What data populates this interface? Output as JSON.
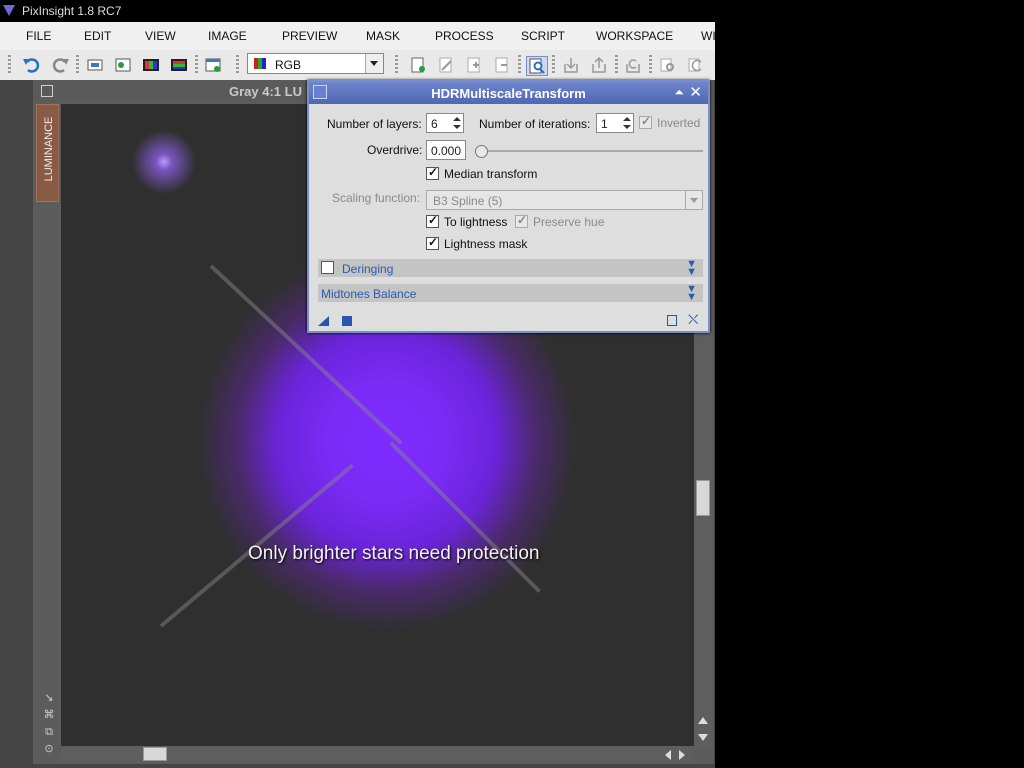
{
  "window": {
    "title": "PixInsight 1.8 RC7"
  },
  "menu": [
    "FILE",
    "EDIT",
    "VIEW",
    "IMAGE",
    "PREVIEW",
    "MASK",
    "PROCESS",
    "SCRIPT",
    "WORKSPACE",
    "WI"
  ],
  "toolbar": {
    "color_mode": "RGB"
  },
  "image_window": {
    "title": "Gray 4:1 LU",
    "side_tab": "LUMINANCE",
    "overlay_caption": "Only brighter stars need protection"
  },
  "dialog": {
    "title": "HDRMultiscaleTransform",
    "layers_label": "Number of layers:",
    "layers_value": "6",
    "iterations_label": "Number of iterations:",
    "iterations_value": "1",
    "inverted_label": "Inverted",
    "overdrive_label": "Overdrive:",
    "overdrive_value": "0.000",
    "median_label": "Median transform",
    "scaling_label": "Scaling function:",
    "scaling_value": "B3 Spline (5)",
    "to_lightness_label": "To lightness",
    "preserve_hue_label": "Preserve hue",
    "lightness_mask_label": "Lightness mask",
    "deringing_label": "Deringing",
    "midtones_label": "Midtones Balance",
    "checked": {
      "inverted": true,
      "median": true,
      "to_lightness": true,
      "preserve_hue": true,
      "lightness_mask": true,
      "deringing": false
    }
  }
}
